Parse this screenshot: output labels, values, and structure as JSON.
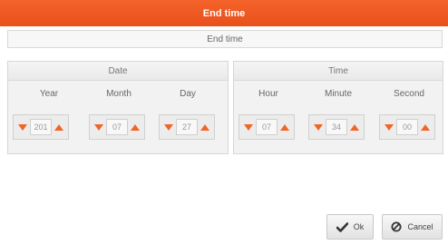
{
  "dialog": {
    "title": "End time",
    "subtitle": "End time"
  },
  "date_group": {
    "heading": "Date",
    "fields": [
      {
        "label": "Year",
        "value": "201"
      },
      {
        "label": "Month",
        "value": "07"
      },
      {
        "label": "Day",
        "value": "27"
      }
    ]
  },
  "time_group": {
    "heading": "Time",
    "fields": [
      {
        "label": "Hour",
        "value": "07"
      },
      {
        "label": "Minute",
        "value": "34"
      },
      {
        "label": "Second",
        "value": "00"
      }
    ]
  },
  "buttons": {
    "ok_label": "Ok",
    "cancel_label": "Cancel"
  },
  "colors": {
    "accent": "#f06528",
    "titlebar": "#ec561f"
  },
  "icons": {
    "decrement": "arrow-down-icon",
    "increment": "arrow-up-icon",
    "ok": "check-icon",
    "cancel": "cancel-circle-icon"
  }
}
